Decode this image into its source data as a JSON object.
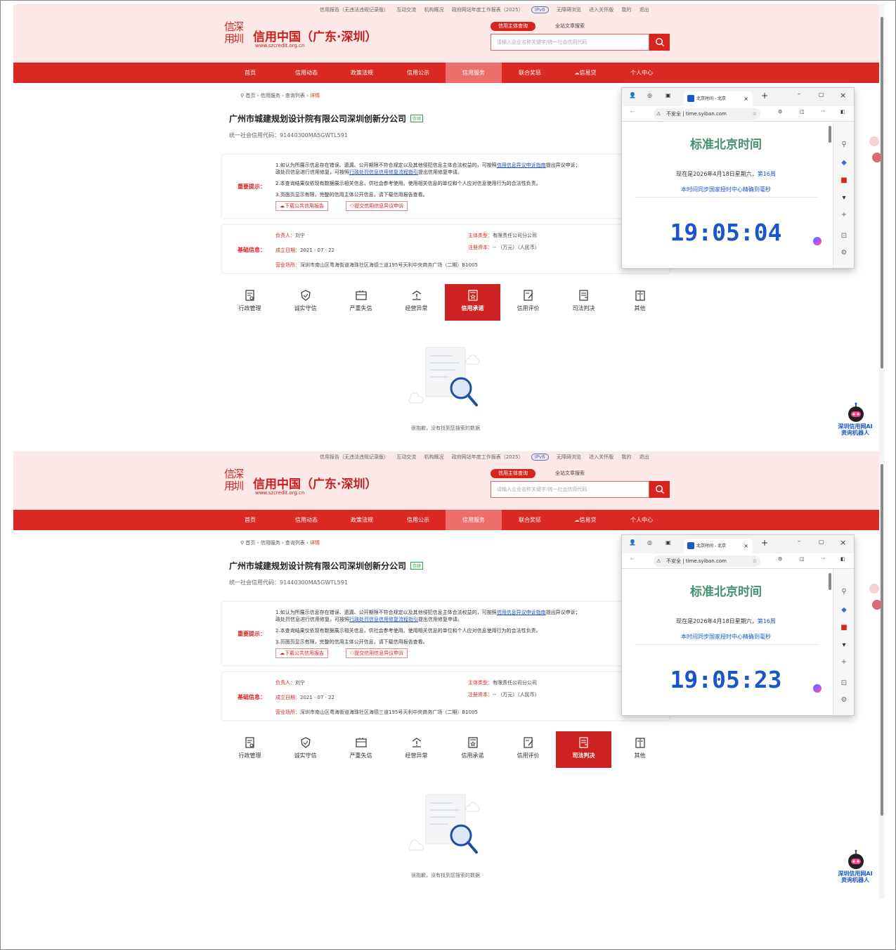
{
  "top_links": [
    "信用报告（无违法违规记录版）",
    "互动交流",
    "机构概况",
    "政府网站年度工作报表（2025）",
    "IPv6",
    "无障碍浏览",
    "进入关怀版",
    "我的",
    "退出"
  ],
  "logo": {
    "mark": "信深用圳",
    "title": "信用中国（广东·深圳）",
    "url": "www.szcredit.org.cn"
  },
  "search": {
    "tab_active": "信用主体查询",
    "tab_other": "全站文章搜索",
    "placeholder": "请输入企业名称关键字/统一社会信用代码"
  },
  "nav": [
    "首页",
    "信用动态",
    "政策法规",
    "信用公示",
    "信用服务",
    "联合奖惩",
    "信易贷",
    "个人中心"
  ],
  "breadcrumb": {
    "home": "首页",
    "service": "信用服务",
    "list": "查询列表",
    "current": "详情"
  },
  "company": {
    "name": "广州市城建规划设计院有限公司深圳创新分公司",
    "status": "存续",
    "code_label": "统一社会信用代码：91440300MA5GWTL591"
  },
  "notice": {
    "label": "重要提示：",
    "line1a": "1.如认为所展示信息存在错误、遗漏、公开期限不符合规定以及其他侵犯信息主体合法权益的，可按照",
    "line1_link": "信用信息异议申诉指南",
    "line1b": "提出异议申诉；",
    "line2a": "政处罚信息进行信用修复，可按照",
    "line2_link": "行政处罚信息信用修复流程指引",
    "line2b": "提出信用修复申请。",
    "line3": "2.本查询结果仅依现有数据展示相关信息，供社会参考使用。使用相关信息的单位和个人应对信息使用行为的合法性负责。",
    "line4": "3.页面页显示有限，完整的信用主体公开信息，请下载信用报告查看。",
    "btn_report": "下载公共信用报告",
    "btn_objection": "提交信用信息异议申诉"
  },
  "basic": {
    "label": "基础信息：",
    "person_k": "负责人：",
    "person_v": "刘宁",
    "type_k": "主体类型：",
    "type_v": "有限责任公司分公司",
    "date_k": "成立日期：",
    "date_v": "2021 · 07 · 22",
    "capital_k": "注册资本：",
    "capital_v": "-- （万元）（人民币）",
    "addr_k": "营业场所：",
    "addr_v": "深圳市南山区粤海街道海珠社区海德三道195号天利中央商务广场（二期）B1005"
  },
  "categories": [
    "行政管理",
    "诚实守信",
    "严重失信",
    "经营异常",
    "信用承诺",
    "信用评价",
    "司法判决",
    "其他"
  ],
  "empty_msg": "很抱歉，没有找到您搜索的数据",
  "browser": {
    "tab_title": "北京时间 - 北京",
    "insecure": "不安全",
    "url": "time.syiban.com",
    "title": "标准北京时间",
    "date_prefix": "现在是2026年4月18日星期六，",
    "week": "第16周",
    "sync": "本时间同步国家授时中心精确到毫秒"
  },
  "robot_label_1": "深圳信用网AI",
  "robot_label_2": "资询机器人",
  "shots": [
    {
      "active_category": "信用承诺",
      "clock": "19:05:04"
    },
    {
      "active_category": "司法判决",
      "clock": "19:05:23"
    }
  ],
  "colors": {
    "brand_red": "#db2825",
    "header_pink": "#fce8e7",
    "clock_blue": "#1a56c8",
    "title_green": "#46916d"
  }
}
